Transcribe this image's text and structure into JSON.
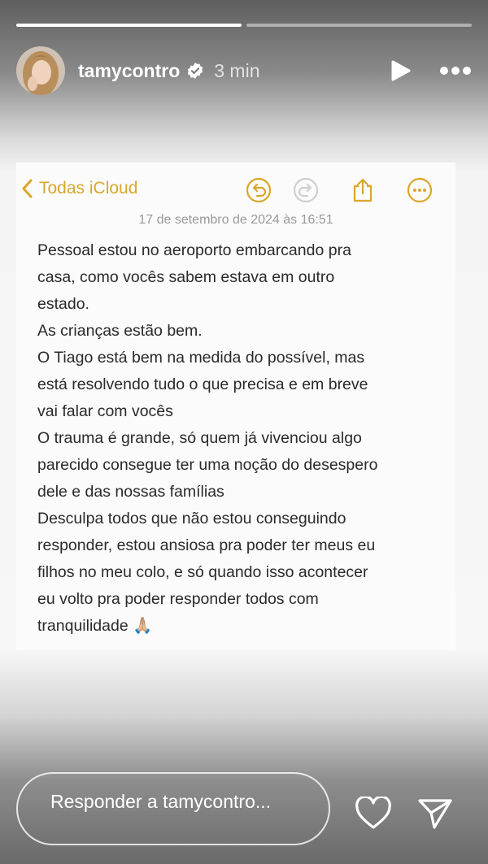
{
  "story": {
    "progress_segments": [
      1.0,
      0.0
    ]
  },
  "header": {
    "username": "tamycontro",
    "verified_icon": "verified-badge-icon",
    "time_ago": "3 min",
    "play_icon": "play-icon",
    "more_icon": "more-horizontal-icon"
  },
  "note": {
    "back_label": "Todas iCloud",
    "toolbar_icons": [
      "undo-icon",
      "redo-icon",
      "share-icon",
      "more-circle-icon"
    ],
    "accent_color": "#d9a72a",
    "date": "17 de setembro de 2024 às 16:51",
    "lines": [
      "Pessoal estou no aeroporto embarcando pra",
      "casa, como vocês sabem estava em outro",
      "estado.",
      "As crianças estão bem.",
      "O Tiago está bem na medida do possível, mas",
      "está resolvendo tudo o que precisa e em breve",
      "vai falar com vocês",
      "O trauma é grande, só quem já vivenciou algo",
      "parecido consegue ter uma noção do desespero",
      "dele e das nossas famílias",
      "Desculpa todos que não estou conseguindo",
      "responder, estou ansiosa pra poder ter meus eu",
      "filhos no meu colo, e só quando isso acontecer",
      "eu volto pra poder responder todos com",
      "tranquilidade 🙏🏼"
    ]
  },
  "reply": {
    "placeholder": "Responder a tamycontro..."
  },
  "actions": {
    "like_icon": "heart-icon",
    "send_icon": "send-icon"
  }
}
